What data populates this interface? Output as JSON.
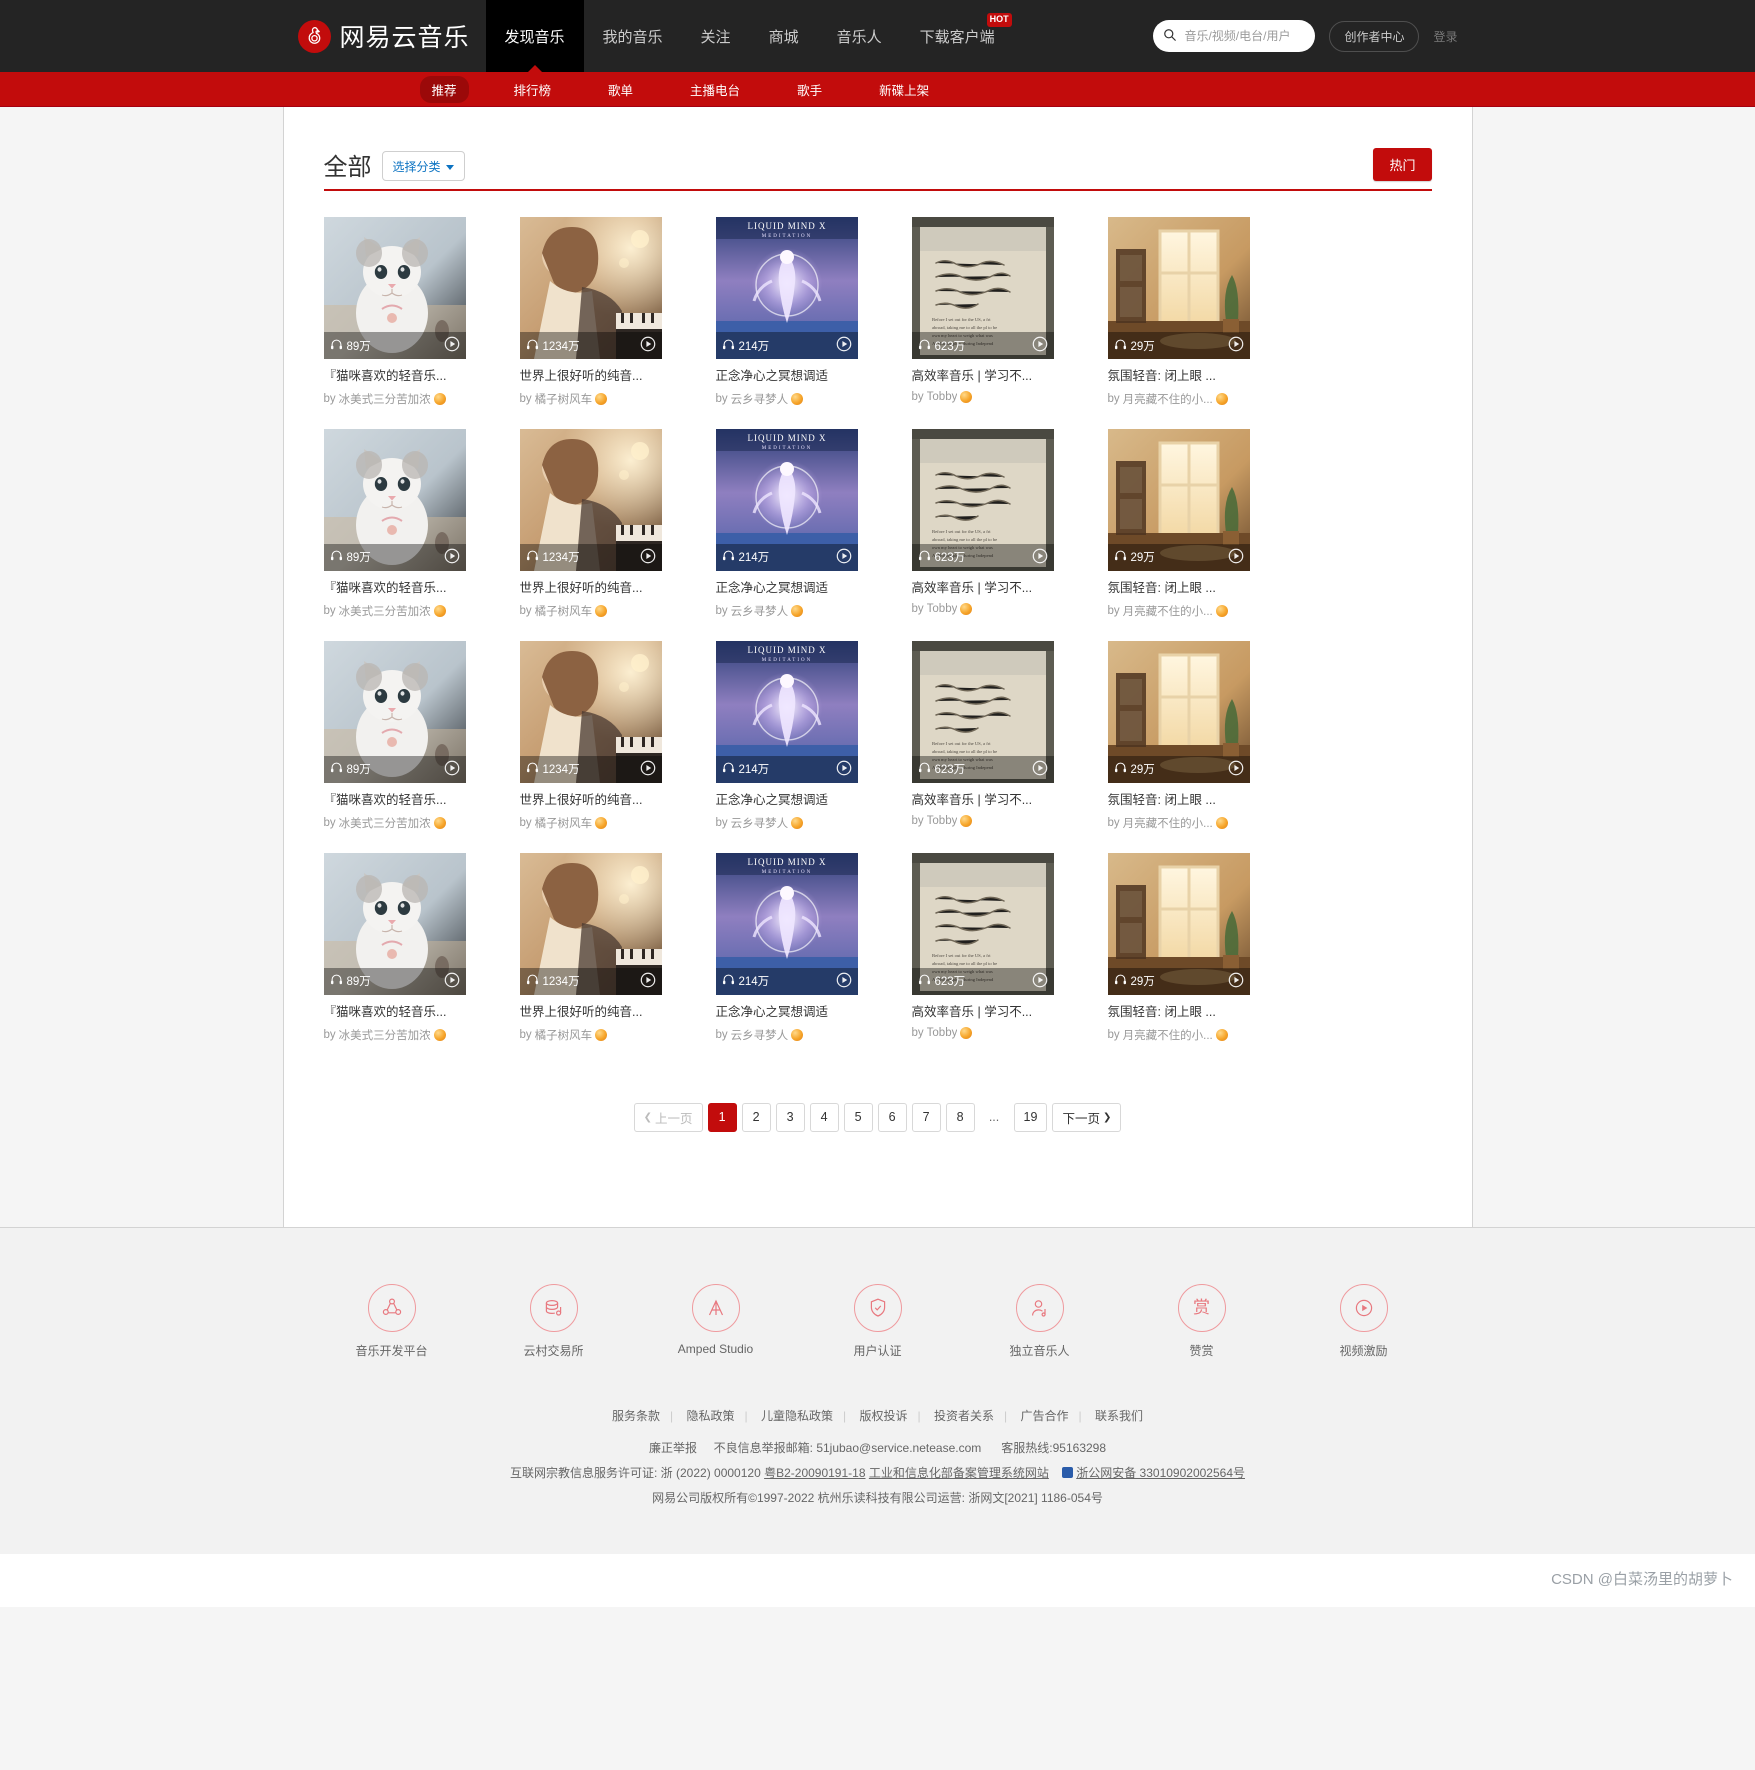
{
  "header": {
    "logo_text": "网易云音乐",
    "logo_icon": "netease-music-logo-icon",
    "nav": [
      {
        "label": "发现音乐",
        "active": true
      },
      {
        "label": "我的音乐",
        "active": false
      },
      {
        "label": "关注",
        "active": false
      },
      {
        "label": "商城",
        "active": false
      },
      {
        "label": "音乐人",
        "active": false
      },
      {
        "label": "下载客户端",
        "active": false,
        "badge": "HOT"
      }
    ],
    "search": {
      "placeholder": "音乐/视频/电台/用户",
      "value": "",
      "icon": "search-icon"
    },
    "creator_button": "创作者中心",
    "login_link": "登录"
  },
  "subnav": {
    "items": [
      {
        "label": "推荐",
        "active": true
      },
      {
        "label": "排行榜",
        "active": false
      },
      {
        "label": "歌单",
        "active": false
      },
      {
        "label": "主播电台",
        "active": false
      },
      {
        "label": "歌手",
        "active": false
      },
      {
        "label": "新碟上架",
        "active": false
      }
    ]
  },
  "filter": {
    "title": "全部",
    "select_label": "选择分类",
    "hot_button": "热门"
  },
  "cards": [
    {
      "title": "『猫咪喜欢的轻音乐...",
      "author": "冰美式三分苦加浓",
      "plays": "89万",
      "cover": "cat"
    },
    {
      "title": "世界上很好听的纯音...",
      "author": "橘子树风车",
      "plays": "1234万",
      "cover": "piano"
    },
    {
      "title": "正念净心之冥想调适",
      "author": "云乡寻梦人",
      "plays": "214万",
      "cover": "meditation"
    },
    {
      "title": "高效率音乐 | 学习不...",
      "author": "Tobby",
      "plays": "623万",
      "cover": "letter"
    },
    {
      "title": "氛围轻音: 闭上眼 ...",
      "author": "月亮藏不住的小...",
      "plays": "29万",
      "cover": "room"
    },
    {
      "title": "『猫咪喜欢的轻音乐...",
      "author": "冰美式三分苦加浓",
      "plays": "89万",
      "cover": "cat"
    },
    {
      "title": "世界上很好听的纯音...",
      "author": "橘子树风车",
      "plays": "1234万",
      "cover": "piano"
    },
    {
      "title": "正念净心之冥想调适",
      "author": "云乡寻梦人",
      "plays": "214万",
      "cover": "meditation"
    },
    {
      "title": "高效率音乐 | 学习不...",
      "author": "Tobby",
      "plays": "623万",
      "cover": "letter"
    },
    {
      "title": "氛围轻音: 闭上眼 ...",
      "author": "月亮藏不住的小...",
      "plays": "29万",
      "cover": "room"
    },
    {
      "title": "『猫咪喜欢的轻音乐...",
      "author": "冰美式三分苦加浓",
      "plays": "89万",
      "cover": "cat"
    },
    {
      "title": "世界上很好听的纯音...",
      "author": "橘子树风车",
      "plays": "1234万",
      "cover": "piano"
    },
    {
      "title": "正念净心之冥想调适",
      "author": "云乡寻梦人",
      "plays": "214万",
      "cover": "meditation"
    },
    {
      "title": "高效率音乐 | 学习不...",
      "author": "Tobby",
      "plays": "623万",
      "cover": "letter"
    },
    {
      "title": "氛围轻音: 闭上眼 ...",
      "author": "月亮藏不住的小...",
      "plays": "29万",
      "cover": "room"
    },
    {
      "title": "『猫咪喜欢的轻音乐...",
      "author": "冰美式三分苦加浓",
      "plays": "89万",
      "cover": "cat"
    },
    {
      "title": "世界上很好听的纯音...",
      "author": "橘子树风车",
      "plays": "1234万",
      "cover": "piano"
    },
    {
      "title": "正念净心之冥想调适",
      "author": "云乡寻梦人",
      "plays": "214万",
      "cover": "meditation"
    },
    {
      "title": "高效率音乐 | 学习不...",
      "author": "Tobby",
      "plays": "623万",
      "cover": "letter"
    },
    {
      "title": "氛围轻音: 闭上眼 ...",
      "author": "月亮藏不住的小...",
      "plays": "29万",
      "cover": "room"
    }
  ],
  "pagination": {
    "prev": "上一页",
    "next": "下一页",
    "pages": [
      "1",
      "2",
      "3",
      "4",
      "5",
      "6",
      "7",
      "8",
      "...",
      "19"
    ],
    "current": "1"
  },
  "footer": {
    "services": [
      {
        "label": "音乐开发平台",
        "icon": "music-dev-platform-icon"
      },
      {
        "label": "云村交易所",
        "icon": "cloud-village-exchange-icon"
      },
      {
        "label": "Amped Studio",
        "icon": "amped-studio-icon"
      },
      {
        "label": "用户认证",
        "icon": "user-verify-shield-icon"
      },
      {
        "label": "独立音乐人",
        "icon": "independent-musician-icon"
      },
      {
        "label": "赞赏",
        "icon": "reward-icon"
      },
      {
        "label": "视频激励",
        "icon": "video-incentive-icon"
      }
    ],
    "links": [
      "服务条款",
      "隐私政策",
      "儿童隐私政策",
      "版权投诉",
      "投资者关系",
      "广告合作",
      "联系我们"
    ],
    "report_label": "廉正举报",
    "report_mail": "不良信息举报邮箱: 51jubao@service.netease.com",
    "hotline": "客服热线:95163298",
    "license_prefix": "互联网宗教信息服务许可证: 浙 (2022) 0000120",
    "license_icp": "粤B2-20090191-18",
    "license_gov": "工业和信息化部备案管理系统网站",
    "license_police": "浙公网安备 33010902002564号",
    "copyright": "网易公司版权所有©1997-2022    杭州乐读科技有限公司运营: 浙网文[2021] 1186-054号"
  },
  "watermark": "CSDN @白菜汤里的胡萝卜",
  "colors": {
    "brand_red": "#c20c0c",
    "nav_dark": "#242424",
    "link_blue": "#0c73c2"
  }
}
